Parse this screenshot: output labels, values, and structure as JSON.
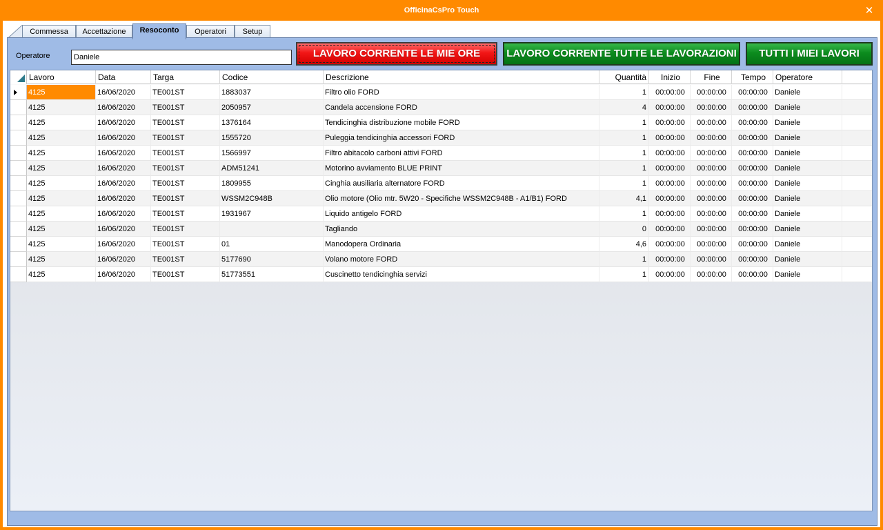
{
  "window": {
    "title": "OfficinaCsPro Touch",
    "close_glyph": "✕"
  },
  "tabs": [
    {
      "label": "Commessa",
      "active": false
    },
    {
      "label": "Accettazione",
      "active": false
    },
    {
      "label": "Resoconto",
      "active": true
    },
    {
      "label": "Operatori",
      "active": false
    },
    {
      "label": "Setup",
      "active": false
    }
  ],
  "operator": {
    "label": "Operatore",
    "value": "Daniele"
  },
  "buttons": {
    "current_my_hours": "LAVORO CORRENTE LE MIE ORE",
    "current_all_jobs": "LAVORO CORRENTE TUTTE LE LAVORAZIONI",
    "all_my_jobs": "TUTTI I MIEI LAVORI"
  },
  "colors": {
    "accent": "#ff8a00",
    "tab_body": "#9fbbe6",
    "red_button": "#e00000",
    "green_button": "#0c8c1e"
  },
  "grid": {
    "columns": [
      "Lavoro",
      "Data",
      "Targa",
      "Codice",
      "Descrizione",
      "Quantità",
      "Inizio",
      "Fine",
      "Tempo",
      "Operatore"
    ],
    "rows": [
      [
        "4125",
        "16/06/2020",
        "TE001ST",
        "1883037",
        "Filtro olio FORD",
        "1",
        "00:00:00",
        "00:00:00",
        "00:00:00",
        "Daniele"
      ],
      [
        "4125",
        "16/06/2020",
        "TE001ST",
        "2050957",
        "Candela accensione FORD",
        "4",
        "00:00:00",
        "00:00:00",
        "00:00:00",
        "Daniele"
      ],
      [
        "4125",
        "16/06/2020",
        "TE001ST",
        "1376164",
        "Tendicinghia distribuzione mobile FORD",
        "1",
        "00:00:00",
        "00:00:00",
        "00:00:00",
        "Daniele"
      ],
      [
        "4125",
        "16/06/2020",
        "TE001ST",
        "1555720",
        "Puleggia tendicinghia accessori FORD",
        "1",
        "00:00:00",
        "00:00:00",
        "00:00:00",
        "Daniele"
      ],
      [
        "4125",
        "16/06/2020",
        "TE001ST",
        "1566997",
        "Filtro abitacolo carboni attivi FORD",
        "1",
        "00:00:00",
        "00:00:00",
        "00:00:00",
        "Daniele"
      ],
      [
        "4125",
        "16/06/2020",
        "TE001ST",
        "ADM51241",
        "Motorino avviamento BLUE PRINT",
        "1",
        "00:00:00",
        "00:00:00",
        "00:00:00",
        "Daniele"
      ],
      [
        "4125",
        "16/06/2020",
        "TE001ST",
        "1809955",
        "Cinghia ausiliaria alternatore FORD",
        "1",
        "00:00:00",
        "00:00:00",
        "00:00:00",
        "Daniele"
      ],
      [
        "4125",
        "16/06/2020",
        "TE001ST",
        "WSSM2C948B",
        "Olio motore    (Olio mtr. 5W20 - Specifiche WSSM2C948B - A1/B1) FORD",
        "4,1",
        "00:00:00",
        "00:00:00",
        "00:00:00",
        "Daniele"
      ],
      [
        "4125",
        "16/06/2020",
        "TE001ST",
        "1931967",
        "Liquido antigelo FORD",
        "1",
        "00:00:00",
        "00:00:00",
        "00:00:00",
        "Daniele"
      ],
      [
        "4125",
        "16/06/2020",
        "TE001ST",
        "",
        "Tagliando",
        "0",
        "00:00:00",
        "00:00:00",
        "00:00:00",
        "Daniele"
      ],
      [
        "4125",
        "16/06/2020",
        "TE001ST",
        "01",
        "Manodopera Ordinaria",
        "4,6",
        "00:00:00",
        "00:00:00",
        "00:00:00",
        "Daniele"
      ],
      [
        "4125",
        "16/06/2020",
        "TE001ST",
        "5177690",
        "Volano motore FORD",
        "1",
        "00:00:00",
        "00:00:00",
        "00:00:00",
        "Daniele"
      ],
      [
        "4125",
        "16/06/2020",
        "TE001ST",
        "51773551",
        "Cuscinetto tendicinghia servizi",
        "1",
        "00:00:00",
        "00:00:00",
        "00:00:00",
        "Daniele"
      ]
    ]
  }
}
